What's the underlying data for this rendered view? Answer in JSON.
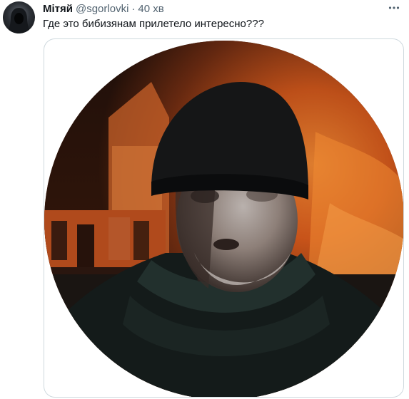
{
  "tweet": {
    "author": {
      "display_name": "Мітяй",
      "handle": "@sgorlovki",
      "avatar_icon": "hooded-figure-avatar"
    },
    "separator": "·",
    "time": "40 хв",
    "more_icon": "more-horizontal-icon",
    "text": "Где это бибизянам прилетело интересно???",
    "media": {
      "kind": "video-still",
      "shape": "circle",
      "subject_icon": "man-in-beanie-photo"
    }
  },
  "colors": {
    "text_primary": "#0f1419",
    "text_secondary": "#536471",
    "border": "#cfd9de",
    "fire_orange": "#e0661c",
    "dark_jacket": "#141b1a"
  }
}
